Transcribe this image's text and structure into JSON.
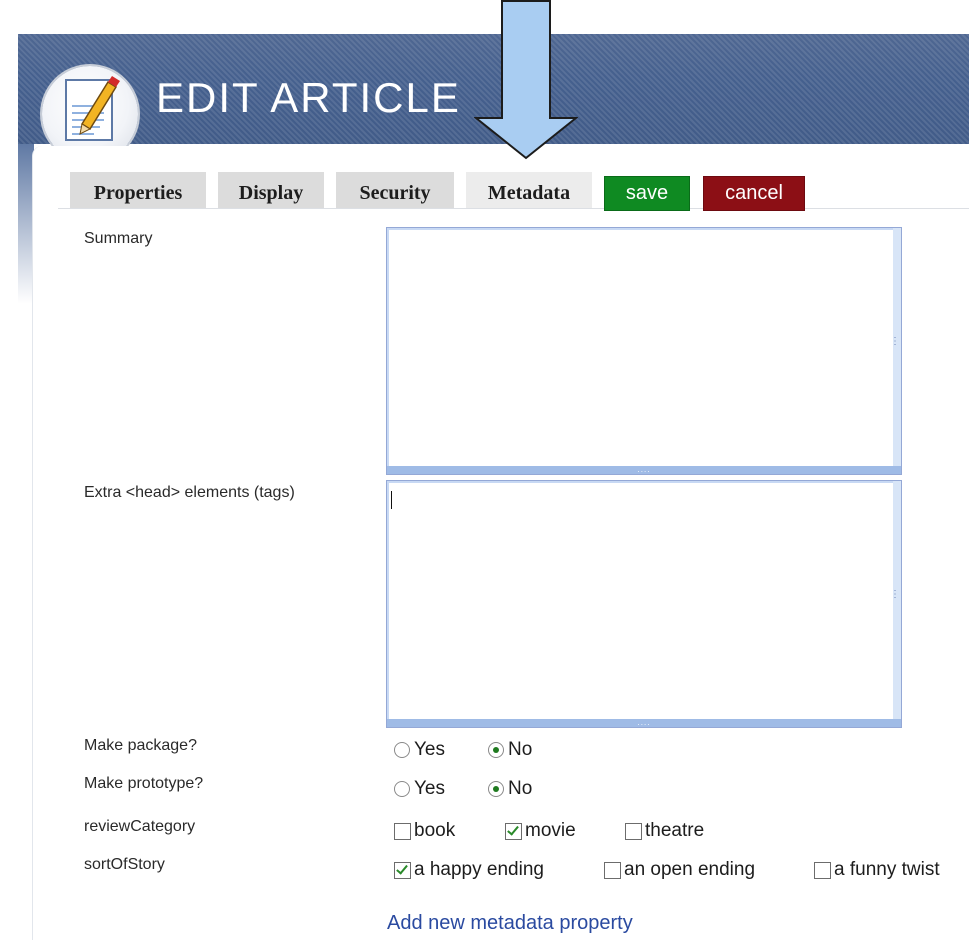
{
  "header": {
    "title": "EDIT ARTICLE",
    "icon": "edit-document-icon"
  },
  "tabs": [
    {
      "label": "Properties",
      "active": false
    },
    {
      "label": "Display",
      "active": false
    },
    {
      "label": "Security",
      "active": false
    },
    {
      "label": "Metadata",
      "active": true
    }
  ],
  "actions": {
    "save_label": "save",
    "cancel_label": "cancel",
    "save_color": "#0f8a22",
    "cancel_color": "#8c0f15"
  },
  "form": {
    "summary": {
      "label": "Summary",
      "value": ""
    },
    "extra_head": {
      "label": "Extra <head> elements (tags)",
      "value": ""
    },
    "make_package": {
      "label": "Make package?",
      "yes": "Yes",
      "no": "No",
      "selected": "No"
    },
    "make_prototype": {
      "label": "Make prototype?",
      "yes": "Yes",
      "no": "No",
      "selected": "No"
    },
    "review_category": {
      "label": "reviewCategory",
      "options": [
        {
          "label": "book",
          "checked": false
        },
        {
          "label": "movie",
          "checked": true
        },
        {
          "label": "theatre",
          "checked": false
        }
      ]
    },
    "sort_of_story": {
      "label": "sortOfStory",
      "options": [
        {
          "label": "a happy ending",
          "checked": true
        },
        {
          "label": "an open ending",
          "checked": false
        },
        {
          "label": "a funny twist",
          "checked": false
        }
      ]
    }
  },
  "links": {
    "add_metadata": "Add new metadata property"
  },
  "annotation": {
    "arrow_color": "#a9cdf2",
    "arrow_icon": "down-arrow-icon"
  }
}
